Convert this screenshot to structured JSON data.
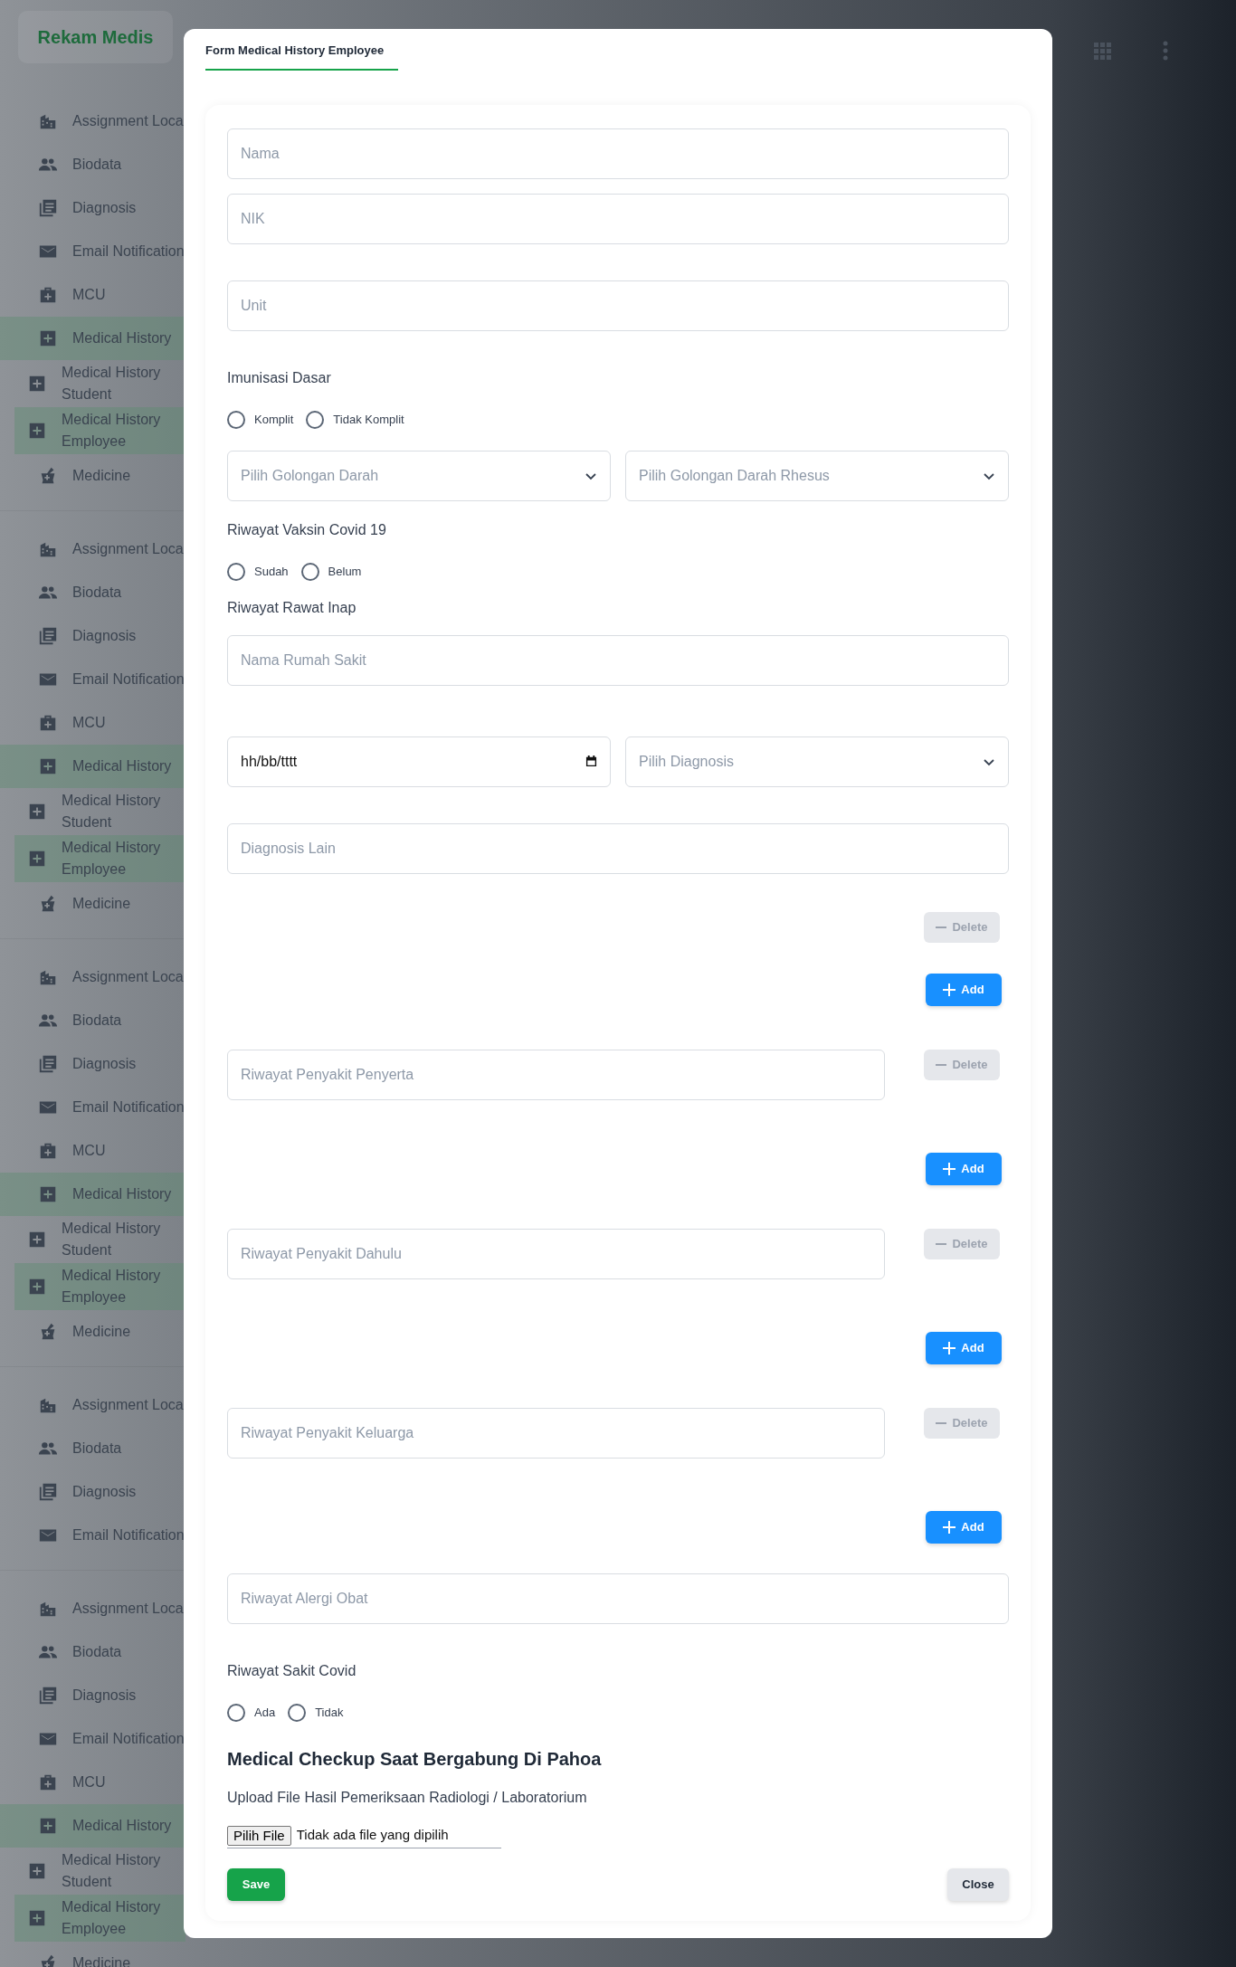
{
  "sidebar": {
    "logo": "Rekam Medis",
    "menus": [
      {
        "items": [
          {
            "label": "Assignment Loca",
            "selected": false
          },
          {
            "label": "Biodata",
            "selected": false
          },
          {
            "label": "Diagnosis",
            "selected": false
          },
          {
            "label": "Email Notification",
            "selected": false
          },
          {
            "label": "MCU",
            "selected": false
          },
          {
            "label": "Medical History",
            "selected": true,
            "children": [
              {
                "label": "Medical History Student",
                "selected": false
              },
              {
                "label": "Medical History Employee",
                "selected": true
              }
            ]
          },
          {
            "label": "Medicine",
            "selected": false
          }
        ]
      },
      {
        "items": [
          {
            "label": "Assignment Loca",
            "selected": false
          },
          {
            "label": "Biodata",
            "selected": false
          },
          {
            "label": "Diagnosis",
            "selected": false
          },
          {
            "label": "Email Notification",
            "selected": false
          },
          {
            "label": "MCU",
            "selected": false
          },
          {
            "label": "Medical History",
            "selected": true,
            "children": [
              {
                "label": "Medical History Student",
                "selected": false
              },
              {
                "label": "Medical History Employee",
                "selected": true
              }
            ]
          },
          {
            "label": "Medicine",
            "selected": false
          }
        ]
      },
      {
        "items": [
          {
            "label": "Assignment Loca",
            "selected": false
          },
          {
            "label": "Biodata",
            "selected": false
          },
          {
            "label": "Diagnosis",
            "selected": false
          },
          {
            "label": "Email Notification",
            "selected": false
          },
          {
            "label": "MCU",
            "selected": false
          },
          {
            "label": "Medical History",
            "selected": true,
            "children": [
              {
                "label": "Medical History Student",
                "selected": false
              },
              {
                "label": "Medical History Employee",
                "selected": true
              }
            ]
          },
          {
            "label": "Medicine",
            "selected": false
          }
        ]
      },
      {
        "items": [
          {
            "label": "Assignment Loca",
            "selected": false
          },
          {
            "label": "Biodata",
            "selected": false
          },
          {
            "label": "Diagnosis",
            "selected": false
          },
          {
            "label": "Email Notification",
            "selected": false
          }
        ]
      },
      {
        "items": [
          {
            "label": "Assignment Loca",
            "selected": false
          },
          {
            "label": "Biodata",
            "selected": false
          },
          {
            "label": "Diagnosis",
            "selected": false
          },
          {
            "label": "Email Notification",
            "selected": false
          },
          {
            "label": "MCU",
            "selected": false
          },
          {
            "label": "Medical History",
            "selected": true,
            "children": [
              {
                "label": "Medical History Student",
                "selected": false
              },
              {
                "label": "Medical History Employee",
                "selected": true
              }
            ]
          },
          {
            "label": "Medicine",
            "selected": false
          }
        ]
      }
    ]
  },
  "modal": {
    "tab": {
      "label": "Form Medical History Employee",
      "selected": true
    },
    "form": [
      {
        "kind": "input",
        "placeholder": "Nama"
      },
      {
        "kind": "input",
        "placeholder": "NIK"
      },
      {
        "kind": "input",
        "placeholder": "Unit"
      },
      {
        "kind": "label",
        "text": "Imunisasi Dasar"
      },
      {
        "kind": "radios",
        "options": [
          {
            "label": "Komplit",
            "selected": false
          },
          {
            "label": "Tidak Komplit",
            "selected": false
          }
        ]
      },
      {
        "kind": "pair",
        "fields": [
          {
            "kind": "select",
            "placeholder": "Pilih Golongan Darah"
          },
          {
            "kind": "select",
            "placeholder": "Pilih Golongan Darah Rhesus"
          }
        ]
      },
      {
        "kind": "label",
        "text": "Riwayat Vaksin Covid 19"
      },
      {
        "kind": "radios",
        "options": [
          {
            "label": "Sudah",
            "selected": false
          },
          {
            "label": "Belum",
            "selected": false
          }
        ]
      },
      {
        "kind": "label",
        "text": "Riwayat Rawat Inap"
      },
      {
        "kind": "input",
        "placeholder": "Nama Rumah Sakit"
      },
      {
        "kind": "pair",
        "fields": [
          {
            "kind": "date",
            "value": "hh/bb/tttt"
          },
          {
            "kind": "select",
            "placeholder": "Pilih Diagnosis"
          }
        ]
      },
      {
        "kind": "input",
        "placeholder": "Diagnosis Lain"
      },
      {
        "kind": "delete",
        "label": "Delete",
        "disabled": true
      },
      {
        "kind": "add",
        "label": "Add"
      },
      {
        "kind": "removable",
        "placeholder": "Riwayat Penyakit Penyerta",
        "button": {
          "label": "Delete",
          "disabled": true
        }
      },
      {
        "kind": "add",
        "label": "Add"
      },
      {
        "kind": "removable",
        "placeholder": "Riwayat Penyakit Dahulu",
        "button": {
          "label": "Delete",
          "disabled": true
        }
      },
      {
        "kind": "add",
        "label": "Add"
      },
      {
        "kind": "removable",
        "placeholder": "Riwayat Penyakit Keluarga",
        "button": {
          "label": "Delete",
          "disabled": true
        }
      },
      {
        "kind": "add",
        "label": "Add"
      },
      {
        "kind": "input",
        "placeholder": "Riwayat Alergi Obat"
      },
      {
        "kind": "label",
        "text": "Riwayat Sakit Covid"
      },
      {
        "kind": "radios",
        "options": [
          {
            "label": "Ada",
            "selected": false
          },
          {
            "label": "Tidak",
            "selected": false
          }
        ]
      },
      {
        "kind": "heading",
        "text": "Medical Checkup Saat Bergabung Di Pahoa"
      },
      {
        "kind": "label",
        "text": "Upload File Hasil Pemeriksaan Radiologi / Laboratorium"
      },
      {
        "kind": "file",
        "button": "Pilih File",
        "status": "Tidak ada file yang dipilih"
      }
    ],
    "save": "Save",
    "close": "Close"
  }
}
